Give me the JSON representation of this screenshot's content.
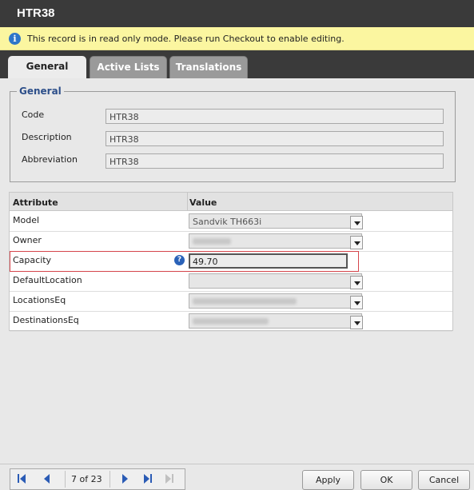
{
  "window": {
    "title": "HTR38"
  },
  "banner": {
    "message": "This record is in read only mode. Please run Checkout to enable editing.",
    "icon": "info-icon"
  },
  "tabs": [
    {
      "label": "General",
      "active": true
    },
    {
      "label": "Active Lists",
      "active": false
    },
    {
      "label": "Translations",
      "active": false
    }
  ],
  "general": {
    "legend": "General",
    "code_label": "Code",
    "code_value": "HTR38",
    "description_label": "Description",
    "description_value": "HTR38",
    "abbreviation_label": "Abbreviation",
    "abbreviation_value": "HTR38"
  },
  "attributes": {
    "header_attribute": "Attribute",
    "header_value": "Value",
    "rows": [
      {
        "label": "Model",
        "value": "Sandvik TH663i"
      },
      {
        "label": "Owner",
        "value": ""
      },
      {
        "label": "Capacity",
        "value": "49.70"
      },
      {
        "label": "DefaultLocation",
        "value": ""
      },
      {
        "label": "LocationsEq",
        "value": ""
      },
      {
        "label": "DestinationsEq",
        "value": ""
      }
    ]
  },
  "footer": {
    "record_position": "7 of 23",
    "apply_label": "Apply",
    "ok_label": "OK",
    "cancel_label": "Cancel"
  },
  "colors": {
    "accent": "#2a5bb5",
    "banner_bg": "#fbf6a0",
    "highlight_border": "#d5454b",
    "titlebar_bg": "#3a3a3a"
  }
}
